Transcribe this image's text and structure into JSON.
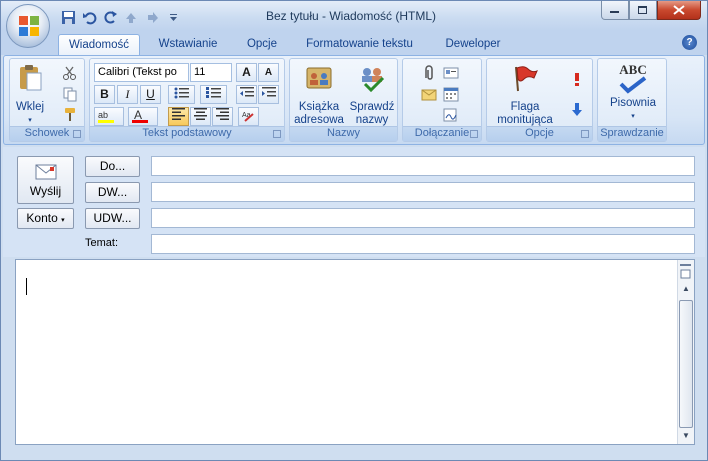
{
  "window": {
    "title": "Bez tytułu - Wiadomość (HTML)"
  },
  "ribbon_tabs": [
    {
      "label": "Wiadomość",
      "active": true
    },
    {
      "label": "Wstawianie",
      "active": false
    },
    {
      "label": "Opcje",
      "active": false
    },
    {
      "label": "Formatowanie tekstu",
      "active": false
    },
    {
      "label": "Deweloper",
      "active": false
    }
  ],
  "groups": {
    "clipboard": {
      "label": "Schowek",
      "paste": "Wklej"
    },
    "basic_text": {
      "label": "Tekst podstawowy",
      "font": "Calibri (Tekst po",
      "size": "11"
    },
    "names": {
      "label": "Nazwy",
      "address_book_l1": "Książka",
      "address_book_l2": "adresowa",
      "check_names_l1": "Sprawdź",
      "check_names_l2": "nazwy"
    },
    "include": {
      "label": "Dołączanie"
    },
    "options": {
      "label": "Opcje",
      "flag_l1": "Flaga",
      "flag_l2": "monitująca"
    },
    "proofing": {
      "label": "Sprawdzanie",
      "spelling": "Pisownia",
      "abc": "ABC"
    }
  },
  "header": {
    "send": "Wyślij",
    "to": "Do...",
    "cc": "DW...",
    "bcc": "UDW...",
    "account": "Konto",
    "subject_label": "Temat:",
    "to_value": "",
    "cc_value": "",
    "bcc_value": "",
    "subject_value": ""
  },
  "body": {
    "text": ""
  },
  "colors": {
    "accent": "#15428b",
    "ribbon_bg": "#dbe7f6",
    "flag": "#d8372a"
  }
}
